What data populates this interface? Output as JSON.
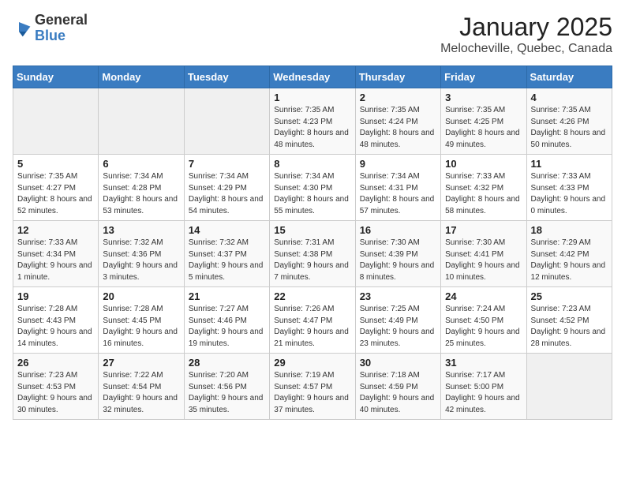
{
  "logo": {
    "general": "General",
    "blue": "Blue"
  },
  "header": {
    "month": "January 2025",
    "location": "Melocheville, Quebec, Canada"
  },
  "weekdays": [
    "Sunday",
    "Monday",
    "Tuesday",
    "Wednesday",
    "Thursday",
    "Friday",
    "Saturday"
  ],
  "weeks": [
    [
      {
        "day": "",
        "info": ""
      },
      {
        "day": "",
        "info": ""
      },
      {
        "day": "",
        "info": ""
      },
      {
        "day": "1",
        "info": "Sunrise: 7:35 AM\nSunset: 4:23 PM\nDaylight: 8 hours\nand 48 minutes."
      },
      {
        "day": "2",
        "info": "Sunrise: 7:35 AM\nSunset: 4:24 PM\nDaylight: 8 hours\nand 48 minutes."
      },
      {
        "day": "3",
        "info": "Sunrise: 7:35 AM\nSunset: 4:25 PM\nDaylight: 8 hours\nand 49 minutes."
      },
      {
        "day": "4",
        "info": "Sunrise: 7:35 AM\nSunset: 4:26 PM\nDaylight: 8 hours\nand 50 minutes."
      }
    ],
    [
      {
        "day": "5",
        "info": "Sunrise: 7:35 AM\nSunset: 4:27 PM\nDaylight: 8 hours\nand 52 minutes."
      },
      {
        "day": "6",
        "info": "Sunrise: 7:34 AM\nSunset: 4:28 PM\nDaylight: 8 hours\nand 53 minutes."
      },
      {
        "day": "7",
        "info": "Sunrise: 7:34 AM\nSunset: 4:29 PM\nDaylight: 8 hours\nand 54 minutes."
      },
      {
        "day": "8",
        "info": "Sunrise: 7:34 AM\nSunset: 4:30 PM\nDaylight: 8 hours\nand 55 minutes."
      },
      {
        "day": "9",
        "info": "Sunrise: 7:34 AM\nSunset: 4:31 PM\nDaylight: 8 hours\nand 57 minutes."
      },
      {
        "day": "10",
        "info": "Sunrise: 7:33 AM\nSunset: 4:32 PM\nDaylight: 8 hours\nand 58 minutes."
      },
      {
        "day": "11",
        "info": "Sunrise: 7:33 AM\nSunset: 4:33 PM\nDaylight: 9 hours\nand 0 minutes."
      }
    ],
    [
      {
        "day": "12",
        "info": "Sunrise: 7:33 AM\nSunset: 4:34 PM\nDaylight: 9 hours\nand 1 minute."
      },
      {
        "day": "13",
        "info": "Sunrise: 7:32 AM\nSunset: 4:36 PM\nDaylight: 9 hours\nand 3 minutes."
      },
      {
        "day": "14",
        "info": "Sunrise: 7:32 AM\nSunset: 4:37 PM\nDaylight: 9 hours\nand 5 minutes."
      },
      {
        "day": "15",
        "info": "Sunrise: 7:31 AM\nSunset: 4:38 PM\nDaylight: 9 hours\nand 7 minutes."
      },
      {
        "day": "16",
        "info": "Sunrise: 7:30 AM\nSunset: 4:39 PM\nDaylight: 9 hours\nand 8 minutes."
      },
      {
        "day": "17",
        "info": "Sunrise: 7:30 AM\nSunset: 4:41 PM\nDaylight: 9 hours\nand 10 minutes."
      },
      {
        "day": "18",
        "info": "Sunrise: 7:29 AM\nSunset: 4:42 PM\nDaylight: 9 hours\nand 12 minutes."
      }
    ],
    [
      {
        "day": "19",
        "info": "Sunrise: 7:28 AM\nSunset: 4:43 PM\nDaylight: 9 hours\nand 14 minutes."
      },
      {
        "day": "20",
        "info": "Sunrise: 7:28 AM\nSunset: 4:45 PM\nDaylight: 9 hours\nand 16 minutes."
      },
      {
        "day": "21",
        "info": "Sunrise: 7:27 AM\nSunset: 4:46 PM\nDaylight: 9 hours\nand 19 minutes."
      },
      {
        "day": "22",
        "info": "Sunrise: 7:26 AM\nSunset: 4:47 PM\nDaylight: 9 hours\nand 21 minutes."
      },
      {
        "day": "23",
        "info": "Sunrise: 7:25 AM\nSunset: 4:49 PM\nDaylight: 9 hours\nand 23 minutes."
      },
      {
        "day": "24",
        "info": "Sunrise: 7:24 AM\nSunset: 4:50 PM\nDaylight: 9 hours\nand 25 minutes."
      },
      {
        "day": "25",
        "info": "Sunrise: 7:23 AM\nSunset: 4:52 PM\nDaylight: 9 hours\nand 28 minutes."
      }
    ],
    [
      {
        "day": "26",
        "info": "Sunrise: 7:23 AM\nSunset: 4:53 PM\nDaylight: 9 hours\nand 30 minutes."
      },
      {
        "day": "27",
        "info": "Sunrise: 7:22 AM\nSunset: 4:54 PM\nDaylight: 9 hours\nand 32 minutes."
      },
      {
        "day": "28",
        "info": "Sunrise: 7:20 AM\nSunset: 4:56 PM\nDaylight: 9 hours\nand 35 minutes."
      },
      {
        "day": "29",
        "info": "Sunrise: 7:19 AM\nSunset: 4:57 PM\nDaylight: 9 hours\nand 37 minutes."
      },
      {
        "day": "30",
        "info": "Sunrise: 7:18 AM\nSunset: 4:59 PM\nDaylight: 9 hours\nand 40 minutes."
      },
      {
        "day": "31",
        "info": "Sunrise: 7:17 AM\nSunset: 5:00 PM\nDaylight: 9 hours\nand 42 minutes."
      },
      {
        "day": "",
        "info": ""
      }
    ]
  ]
}
